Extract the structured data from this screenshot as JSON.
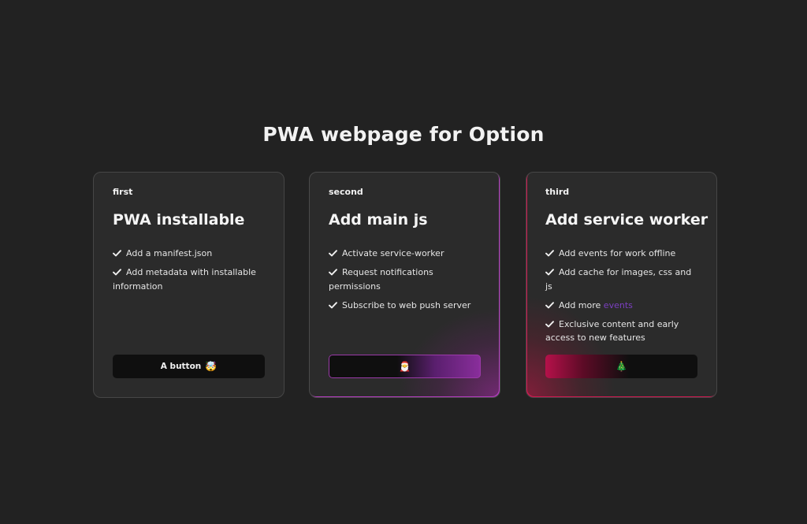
{
  "page": {
    "title": "PWA webpage for Option"
  },
  "cards": [
    {
      "tag": "first",
      "heading": "PWA installable",
      "features": [
        "Add a manifest.json",
        "Add metadata with installable information"
      ],
      "button": {
        "label": "A button",
        "emoji": "🤯"
      }
    },
    {
      "tag": "second",
      "heading": "Add main js",
      "features": [
        "Activate service-worker",
        "Request notifications permissions",
        "Subscribe to web push server"
      ],
      "button": {
        "label": "",
        "emoji": "🎅"
      }
    },
    {
      "tag": "third",
      "heading": "Add service worker",
      "features": [
        "Add events for work offline",
        "Add cache for images, css and js",
        "Add more",
        "Exclusive content and early access to new features"
      ],
      "feature_link": "events",
      "button": {
        "label": "",
        "emoji": "🎄"
      }
    }
  ],
  "icons": {
    "check": "check-icon"
  },
  "colors": {
    "background": "#222222",
    "card": "#2b2b2b",
    "accent_purple": "#8a2e9c",
    "accent_red": "#b5114a",
    "link": "#7b3fc0"
  }
}
